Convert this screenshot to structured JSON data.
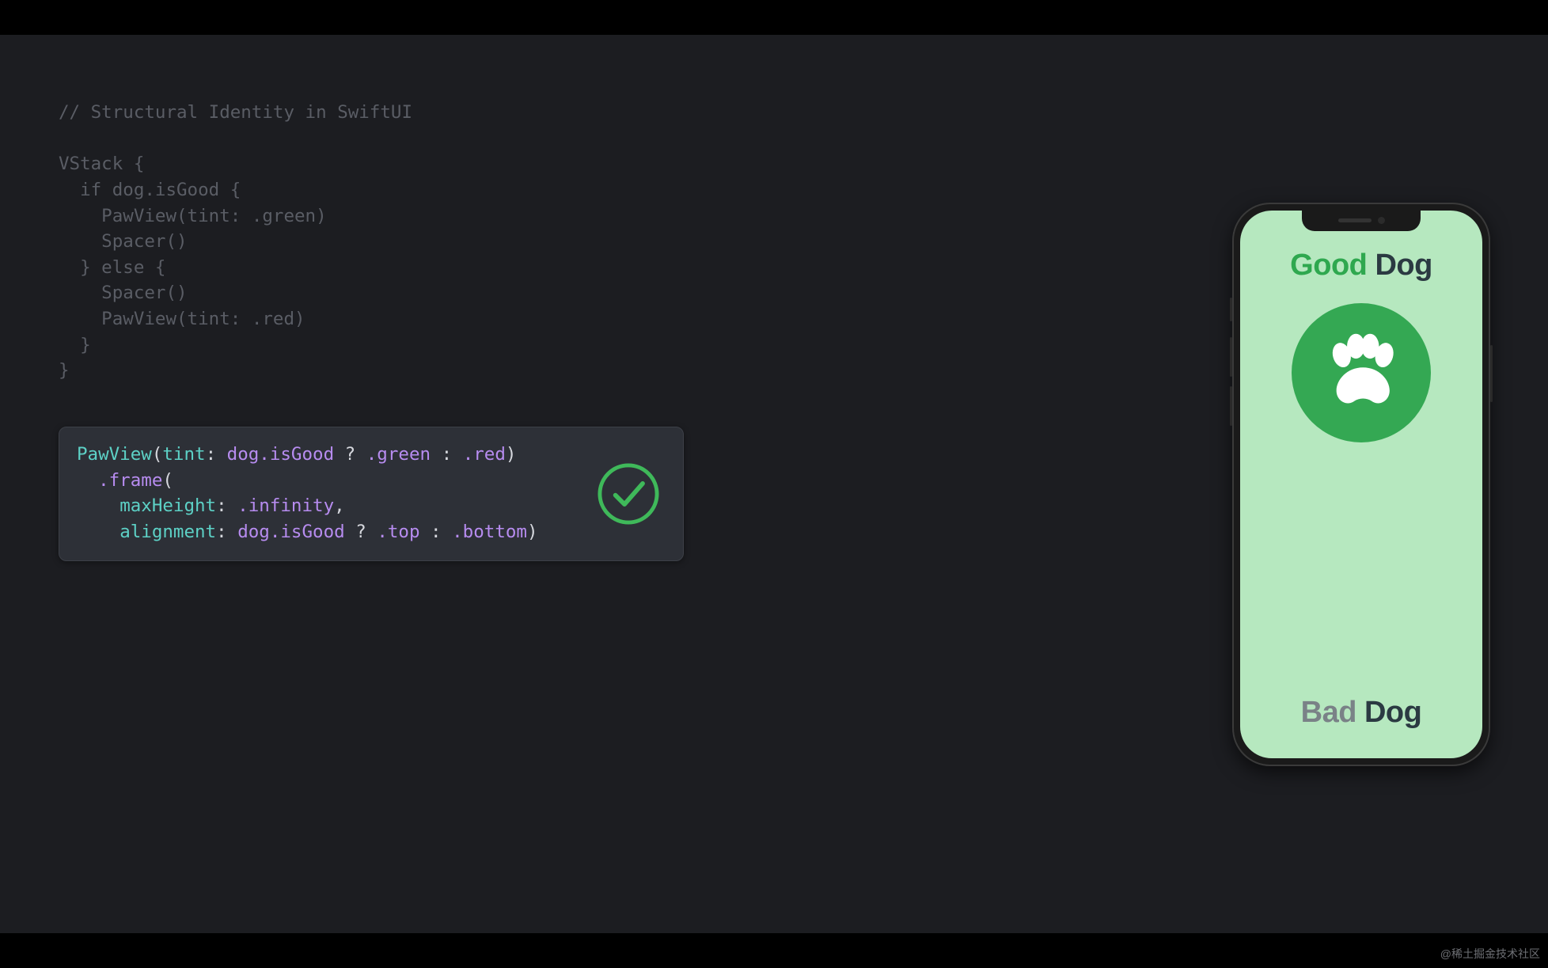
{
  "title_comment": "// Structural Identity in SwiftUI",
  "code_top": {
    "l1": "VStack {",
    "l2": "  if dog.isGood {",
    "l3": "    PawView(tint: .green)",
    "l4": "    Spacer()",
    "l5": "  } else {",
    "l6": "    Spacer()",
    "l7": "    PawView(tint: .red)",
    "l8": "  }",
    "l9": "}"
  },
  "highlight": {
    "PawView": "PawView",
    "open": "(",
    "tint_label": "tint",
    "colon_sp": ": ",
    "dog_isGood": "dog.isGood",
    "q": " ? ",
    "green": ".green",
    "colon_alt": " : ",
    "red": ".red",
    "close": ")",
    "nl_indent": "\n  ",
    "frame": ".frame",
    "open2": "(",
    "nl_indent2": "\n    ",
    "maxHeight_label": "maxHeight",
    "infinity": ".infinity",
    "comma": ",",
    "alignment_label": "alignment",
    "top": ".top",
    "bottom": ".bottom",
    "close2": ")"
  },
  "phone": {
    "good_word1": "Good",
    "good_word2": "Dog",
    "bad_word1": "Bad",
    "bad_word2": "Dog"
  },
  "colors": {
    "accent_green": "#34a853",
    "check_green": "#3fb95a",
    "type_teal": "#5dd1c6",
    "method_purple": "#b78cf0"
  },
  "watermark": "@稀土掘金技术社区"
}
